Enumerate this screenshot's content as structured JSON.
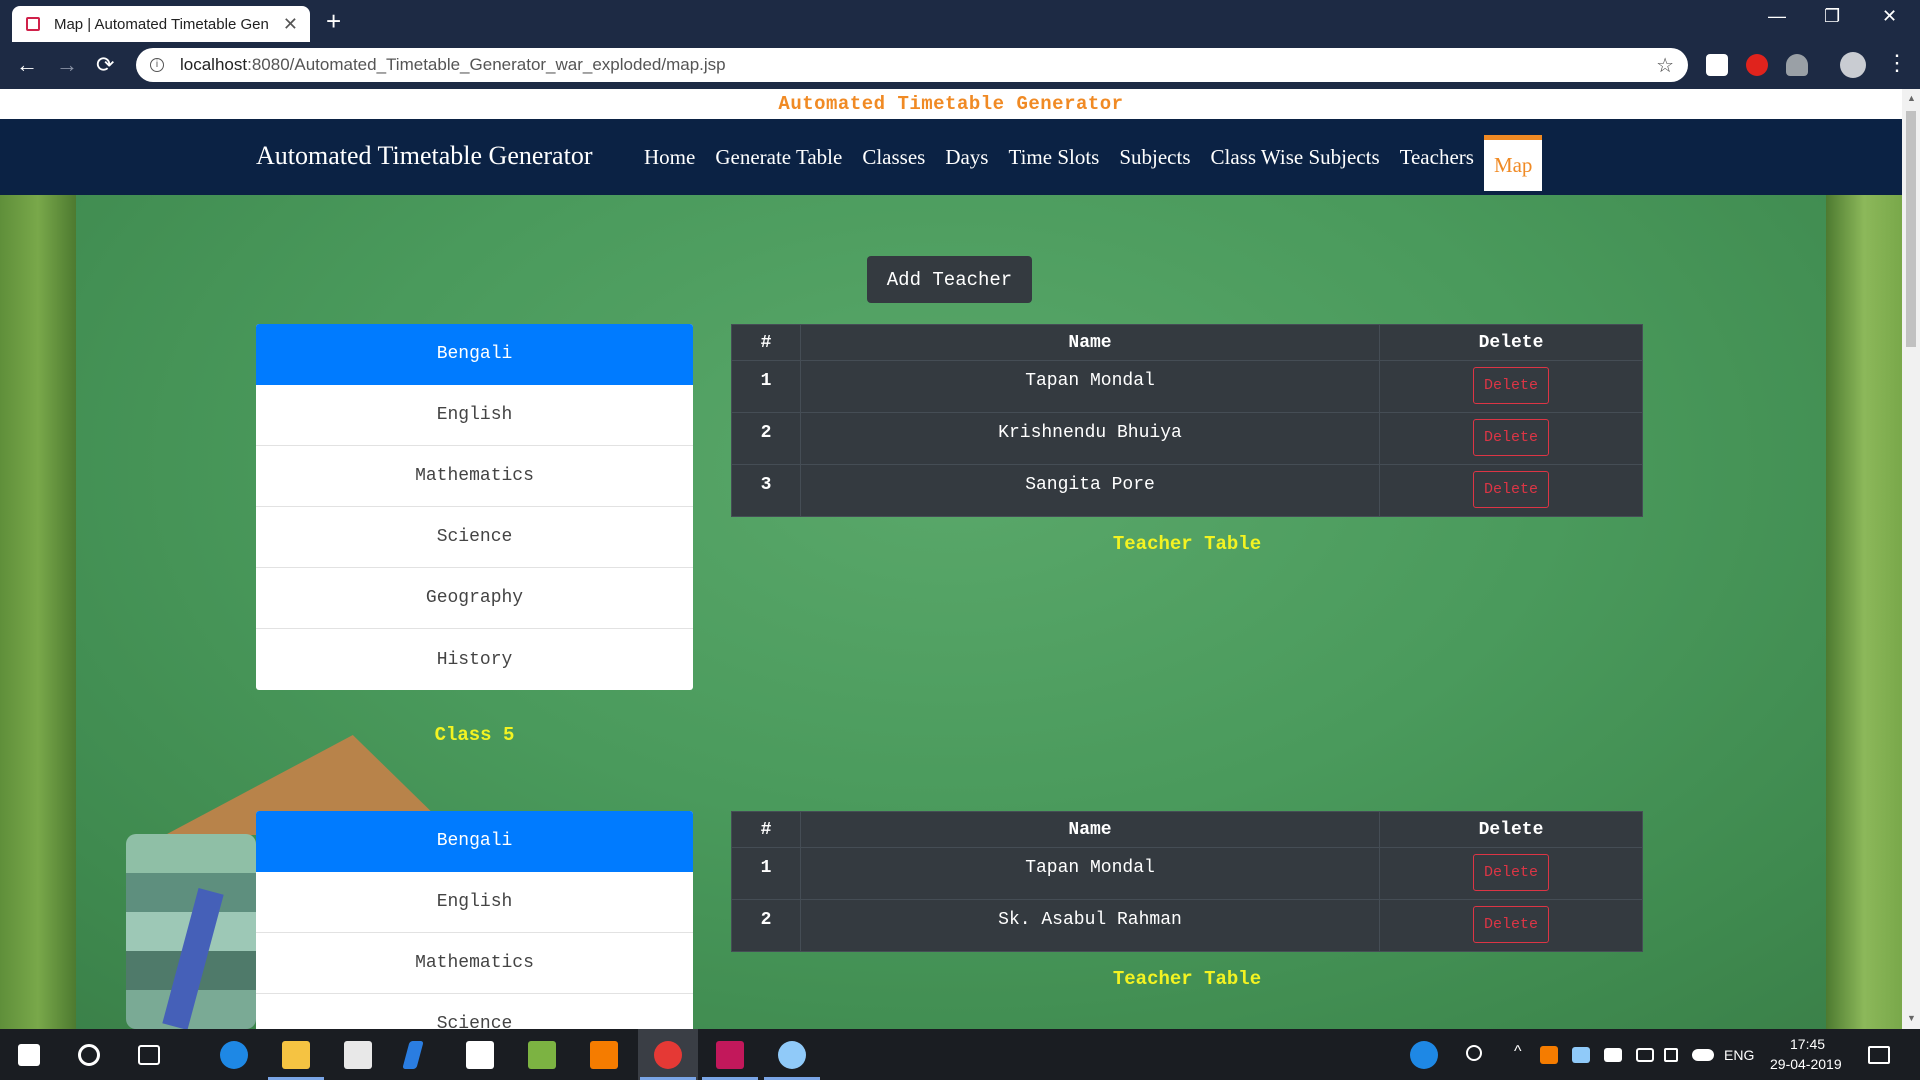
{
  "browser": {
    "tab_title": "Map | Automated Timetable Gen",
    "new_tab_symbol": "+",
    "tab_close_symbol": "✕",
    "url_host": "localhost",
    "url_path": ":8080/Automated_Timetable_Generator_war_exploded/map.jsp",
    "window_controls": [
      "—",
      "❐",
      "✕"
    ],
    "nav_symbols": {
      "back": "←",
      "forward": "→",
      "reload": "⟳"
    },
    "star_symbol": "☆",
    "menu_symbol": "⋮"
  },
  "page": {
    "top_banner": "Automated Timetable Generator",
    "navbar": {
      "brand": "Automated Timetable Generator",
      "items": [
        "Home",
        "Generate Table",
        "Classes",
        "Days",
        "Time Slots",
        "Subjects",
        "Class Wise Subjects",
        "Teachers",
        "Map"
      ],
      "active_item": "Map"
    },
    "add_teacher_label": "Add Teacher",
    "sections": [
      {
        "class_label": "Class 5",
        "subjects": [
          "Bengali",
          "English",
          "Mathematics",
          "Science",
          "Geography",
          "History"
        ],
        "active_subject": "Bengali",
        "table": {
          "headers": [
            "#",
            "Name",
            "Delete"
          ],
          "rows": [
            {
              "num": "1",
              "name": "Tapan Mondal",
              "action": "Delete"
            },
            {
              "num": "2",
              "name": "Krishnendu Bhuiya",
              "action": "Delete"
            },
            {
              "num": "3",
              "name": "Sangita Pore",
              "action": "Delete"
            }
          ],
          "caption": "Teacher Table"
        }
      },
      {
        "subjects": [
          "Bengali",
          "English",
          "Mathematics",
          "Science"
        ],
        "active_subject": "Bengali",
        "table": {
          "headers": [
            "#",
            "Name",
            "Delete"
          ],
          "rows": [
            {
              "num": "1",
              "name": "Tapan Mondal",
              "action": "Delete"
            },
            {
              "num": "2",
              "name": "Sk. Asabul Rahman",
              "action": "Delete"
            }
          ],
          "caption": "Teacher Table"
        }
      }
    ]
  },
  "taskbar": {
    "language": "ENG",
    "time": "17:45",
    "date": "29-04-2019"
  },
  "colors": {
    "navbar_bg": "#0b2244",
    "accent_orange": "#f08a24",
    "active_subject_blue": "#007bff",
    "caption_yellow": "#f3f322",
    "table_dark": "#343a40",
    "delete_red": "#dc3545",
    "board_green": "#4a9a5c"
  }
}
